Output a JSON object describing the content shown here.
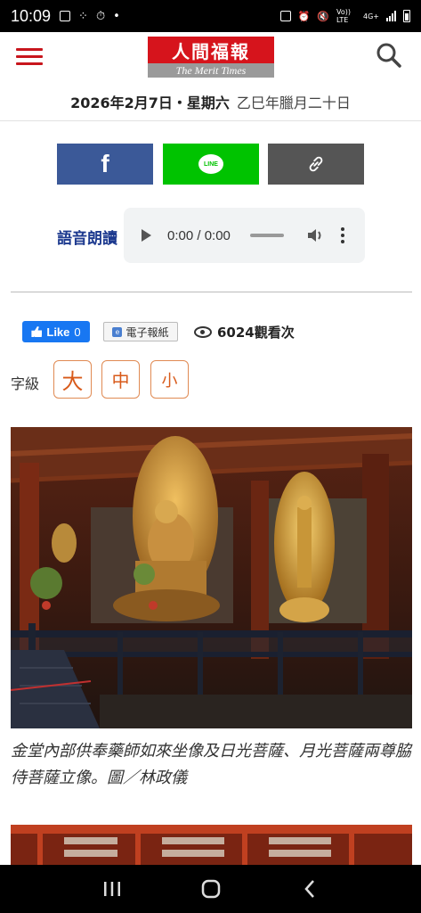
{
  "status_bar": {
    "time": "10:09",
    "network_label": "Vo)) LTE",
    "signal_label": "4G+",
    "icons": [
      "gallery-icon",
      "grid-icon",
      "timer-icon",
      "dot-icon",
      "lock-icon",
      "alarm-icon",
      "mute-icon",
      "wifi-icon",
      "signal-icon",
      "battery-icon"
    ]
  },
  "header": {
    "logo_title": "人間福報",
    "logo_subtitle": "The Merit Times",
    "date": "2026年2月7日・星期六",
    "lunar_date": "乙巳年臘月二十日"
  },
  "share": {
    "facebook": "f",
    "line": "LINE",
    "link_icon": "link-icon"
  },
  "audio": {
    "label": "語音朗讀",
    "time": "0:00 / 0:00"
  },
  "social": {
    "like_label": "Like",
    "like_count": "0",
    "epaper_label": "電子報紙",
    "views": "6024觀看次"
  },
  "font_size": {
    "label": "字級",
    "large": "大",
    "medium": "中",
    "small": "小"
  },
  "article": {
    "caption": "金堂內部供奉藥師如來坐像及日光菩薩、月光菩薩兩尊脇侍菩薩立像。圖／林政儀"
  },
  "colors": {
    "brand_red": "#d6141c",
    "facebook": "#3b5998",
    "line": "#00c300",
    "link": "#555555",
    "voice_label": "#1d3a8f",
    "font_btn": "#d85a1a"
  }
}
